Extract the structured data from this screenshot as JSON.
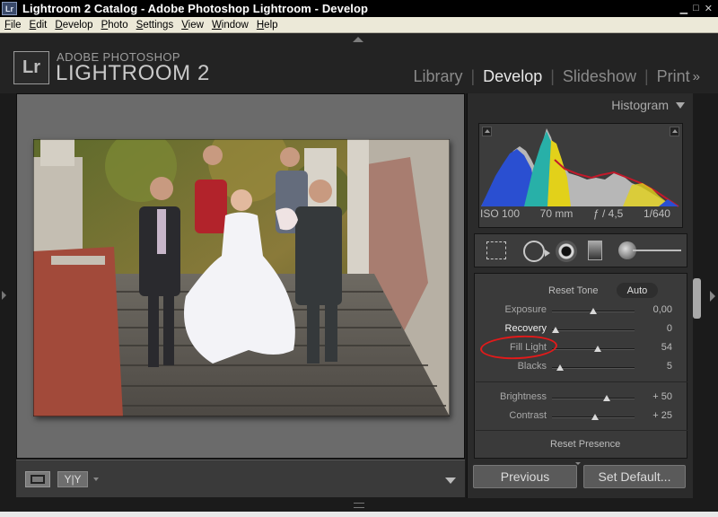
{
  "window": {
    "title": "Lightroom 2 Catalog - Adobe Photoshop Lightroom - Develop",
    "app_icon": "Lr",
    "controls": [
      "minimize-icon",
      "maximize-icon",
      "close-icon"
    ]
  },
  "menu": {
    "items": [
      {
        "underline": "F",
        "rest": "ile"
      },
      {
        "underline": "E",
        "rest": "dit"
      },
      {
        "underline": "D",
        "rest": "evelop"
      },
      {
        "underline": "P",
        "rest": "hoto"
      },
      {
        "underline": "S",
        "rest": "ettings"
      },
      {
        "underline": "V",
        "rest": "iew"
      },
      {
        "underline": "W",
        "rest": "indow"
      },
      {
        "underline": "H",
        "rest": "elp"
      }
    ]
  },
  "brand": {
    "logo": "Lr",
    "small": "ADOBE PHOTOSHOP",
    "large": "LIGHTROOM 2"
  },
  "modules": {
    "library": "Library",
    "develop": "Develop",
    "slideshow": "Slideshow",
    "print": "Print",
    "more": "»",
    "active": "Develop"
  },
  "histogram": {
    "title": "Histogram",
    "exif": {
      "iso": "ISO 100",
      "focal": "70 mm",
      "aperture": "ƒ / 4,5",
      "shutter": "1/640"
    }
  },
  "tools": [
    "crop-icon",
    "spot-removal-icon",
    "red-eye-icon",
    "graduated-filter-icon",
    "adjustment-brush-icon"
  ],
  "basic": {
    "reset_tone": "Reset Tone",
    "auto": "Auto",
    "sliders": [
      {
        "label": "Exposure",
        "value": "0,00",
        "position": 0.5,
        "highlight": false
      },
      {
        "label": "Recovery",
        "value": "0",
        "position": 0.04,
        "highlight": true
      },
      {
        "label": "Fill Light",
        "value": "54",
        "position": 0.55,
        "highlight": false
      },
      {
        "label": "Blacks",
        "value": "5",
        "position": 0.1,
        "highlight": false
      },
      {
        "label": "Brightness",
        "value": "+ 50",
        "position": 0.66,
        "highlight": false
      },
      {
        "label": "Contrast",
        "value": "+ 25",
        "position": 0.52,
        "highlight": false
      }
    ],
    "reset_presence": "Reset Presence"
  },
  "buttons": {
    "previous": "Previous",
    "set_default": "Set Default..."
  },
  "toolbar": {
    "yy": "Y|Y"
  },
  "colors": {
    "annotation": "#e21a1a",
    "panel_bg": "#2b2b2b",
    "canvas_bg": "#6b6b6b"
  }
}
